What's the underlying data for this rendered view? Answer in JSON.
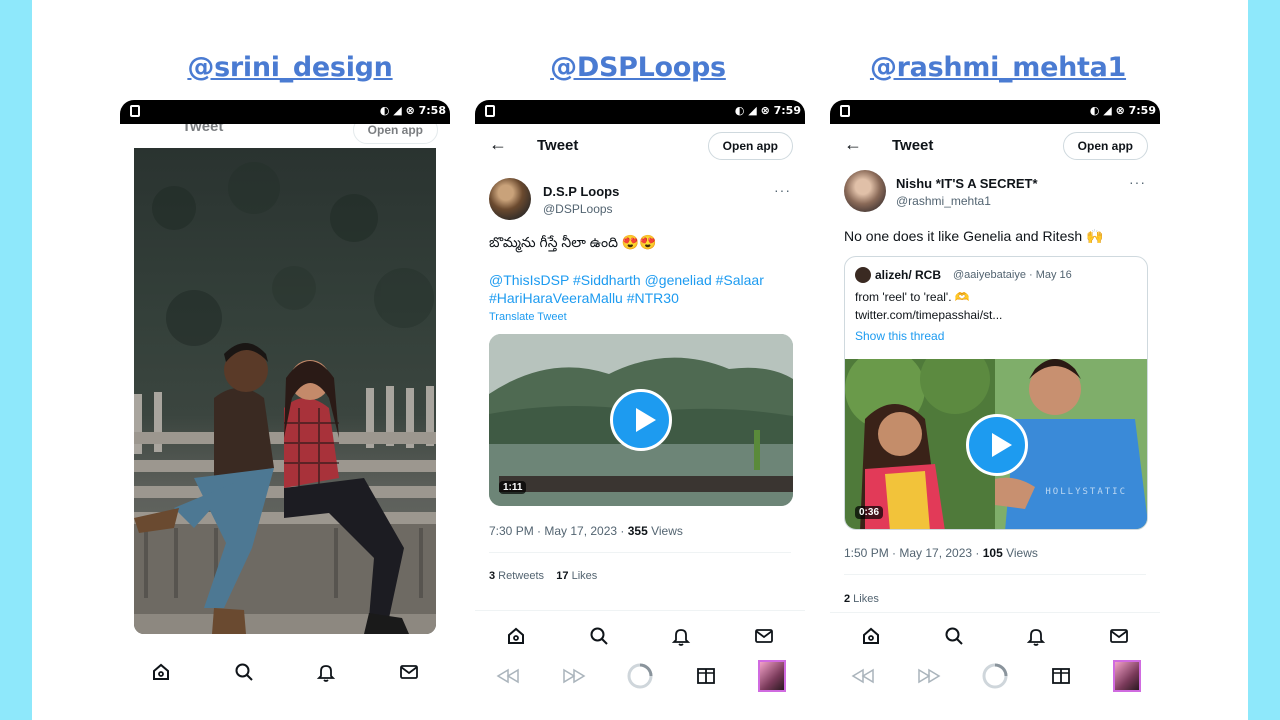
{
  "panels": [
    {
      "handle": "@srini_design",
      "status_time": "7:58",
      "topbar_title": "Tweet",
      "open_app": "Open app"
    },
    {
      "handle": "@DSPLoops",
      "status_time": "7:59",
      "topbar_title": "Tweet",
      "open_app": "Open app",
      "author_name": "D.S.P Loops",
      "author_handle": "@DSPLoops",
      "tweet_text": "బొమ్మను గీస్తే నీలా ఉంది 😍😍",
      "hashtags_line1": "@ThisIsDSP #Siddharth @geneliad #Salaar",
      "hashtags_line2": "#HariHaraVeeraMallu #NTR30",
      "translate": "Translate Tweet",
      "video_duration": "1:11",
      "timestamp": "7:30 PM · May 17, 2023 · ",
      "views_count": "355",
      "views_label": " Views",
      "retweets_count": "3",
      "retweets_label": " Retweets",
      "likes_count": "17",
      "likes_label": " Likes"
    },
    {
      "handle": "@rashmi_mehta1",
      "status_time": "7:59",
      "topbar_title": "Tweet",
      "open_app": "Open app",
      "author_name": "Nishu *IT'S A SECRET*",
      "author_handle": "@rashmi_mehta1",
      "tweet_text": "No one does it like Genelia and Ritesh 🙌",
      "quote_author": "alizeh/ RCB",
      "quote_handle": "@aaiyebataiye · May 16",
      "quote_line1": "from 'reel' to 'real'. 🫶",
      "quote_line2": "twitter.com/timepasshai/st...",
      "quote_show_thread": "Show this thread",
      "video_duration": "0:36",
      "video_watermark": "HOLLYSTATIC",
      "timestamp": "1:50 PM · May 17, 2023 · ",
      "views_count": "105",
      "views_label": " Views",
      "likes_count": "2",
      "likes_label": " Likes"
    }
  ],
  "colors": {
    "background": "#8ee8fb",
    "handle_link": "#4a7bd2",
    "twitter_blue": "#1d9bf0"
  }
}
